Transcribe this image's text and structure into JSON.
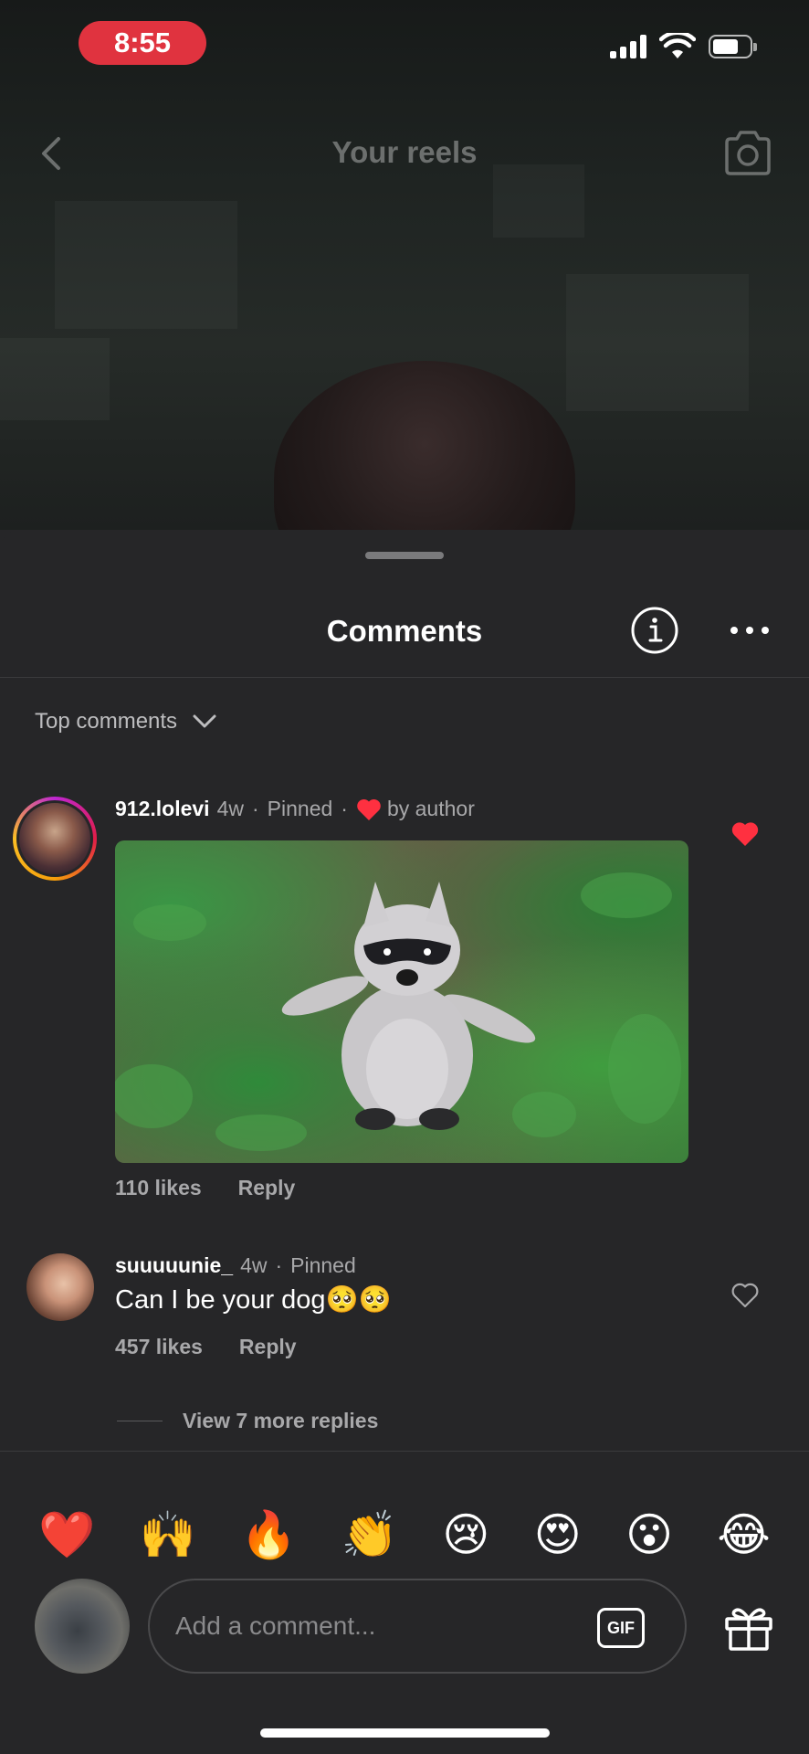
{
  "status_bar": {
    "time": "8:55"
  },
  "reel_header": {
    "title": "Your reels"
  },
  "comments_sheet": {
    "title": "Comments",
    "sort_label": "Top comments",
    "comments": [
      {
        "username": "912.lolevi",
        "age": "4w",
        "pinned": "Pinned",
        "liked_by_author": "by author",
        "likes": "110 likes",
        "reply": "Reply",
        "liked": true
      },
      {
        "username": "suuuuunie_",
        "age": "4w",
        "pinned": "Pinned",
        "text": "Can I be your dog🥺🥺",
        "likes": "457 likes",
        "reply": "Reply",
        "view_replies": "View 7 more replies",
        "liked": false
      }
    ]
  },
  "reactions": [
    "❤️",
    "🙌",
    "🔥",
    "👏",
    "😢",
    "😍",
    "😮",
    "😂"
  ],
  "composer": {
    "placeholder": "Add a comment...",
    "gif_label": "GIF"
  },
  "colors": {
    "background": "#262628",
    "heart": "#ff3040",
    "time_pill": "#e0333f"
  },
  "icons": [
    "back-arrow-icon",
    "camera-icon",
    "info-icon",
    "more-options-icon",
    "chevron-down-icon",
    "heart-icon",
    "gift-icon"
  ]
}
